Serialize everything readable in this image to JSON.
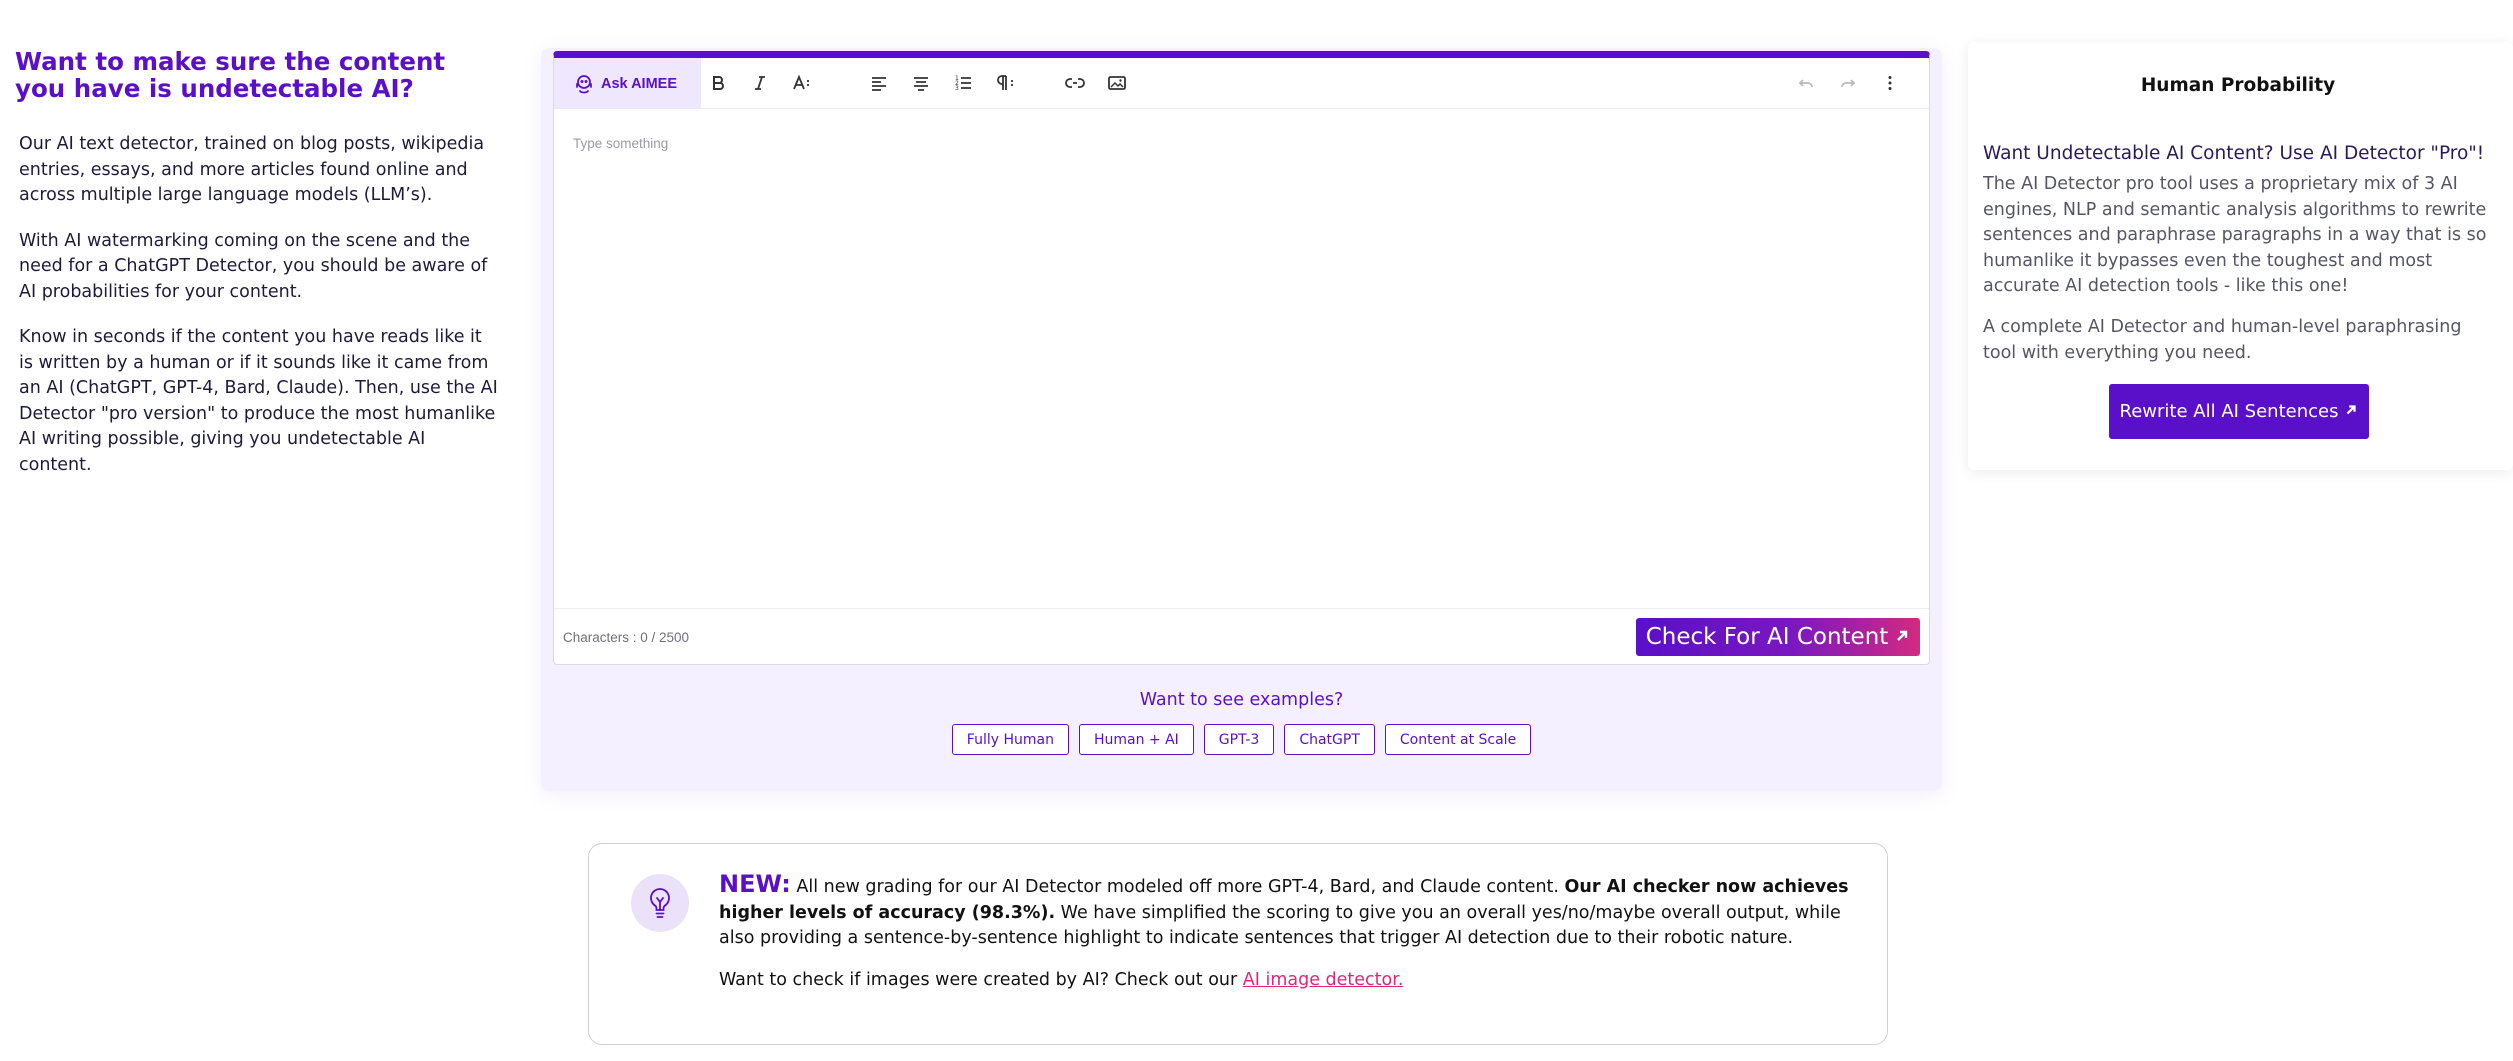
{
  "left": {
    "heading": "Want to make sure the content you have is undetectable AI?",
    "para1": "Our AI text detector, trained on blog posts, wikipedia entries, essays, and more articles found online and across multiple large language models (LLM’s).",
    "para2": "With AI watermarking coming on the scene and the need for a ChatGPT Detector, you should be aware of AI probabilities for your content.",
    "para3": "Know in seconds if the content you have reads like it is written by a human or if it sounds like it came from an AI (ChatGPT, GPT-4, Bard, Claude). Then, use the AI Detector \"pro version\" to produce the most humanlike AI writing possible, giving you undetectable AI content."
  },
  "editor": {
    "ask_label": "Ask AIMEE",
    "placeholder": "Type something",
    "char_count": "Characters : 0  / 2500",
    "check_label": "Check For AI Content",
    "toolbar_icons": [
      "bold-icon",
      "italic-icon",
      "font-size-icon",
      "align-left-icon",
      "align-center-icon",
      "ordered-list-icon",
      "paragraph-icon",
      "link-icon",
      "image-icon",
      "undo-icon",
      "redo-icon",
      "more-icon"
    ]
  },
  "examples": {
    "label": "Want to see examples?",
    "items": [
      "Fully Human",
      "Human + AI",
      "GPT-3",
      "ChatGPT",
      "Content at Scale"
    ]
  },
  "right": {
    "title": "Human Probability",
    "subtitle": "Want Undetectable AI Content? Use AI Detector \"Pro\"!",
    "para1": "The AI Detector pro tool uses a proprietary mix of 3 AI engines, NLP and semantic analysis algorithms to rewrite sentences and paraphrase paragraphs in a way that is so humanlike it bypasses even the toughest and most accurate AI detection tools - like this one!",
    "para2": "A complete AI Detector and human-level paraphrasing tool with everything you need.",
    "button": "Rewrite All AI Sentences"
  },
  "news": {
    "tag": "NEW:",
    "text1": " All new grading for our AI Detector modeled off more GPT-4, Bard, and Claude content. ",
    "bold": "Our AI checker now achieves higher levels of accuracy (98.3%).",
    "text2": " We have simplified the scoring to give you an overall yes/no/maybe overall output, while also providing a sentence-by-sentence highlight to indicate sentences that trigger AI detection due to their robotic nature.",
    "line2": "Want to check if images were created by AI? Check out our ",
    "link": "AI image detector."
  },
  "colors": {
    "brand": "#5a0fc8",
    "accent": "#e0267a",
    "panel_bg": "#f5f0ff"
  }
}
